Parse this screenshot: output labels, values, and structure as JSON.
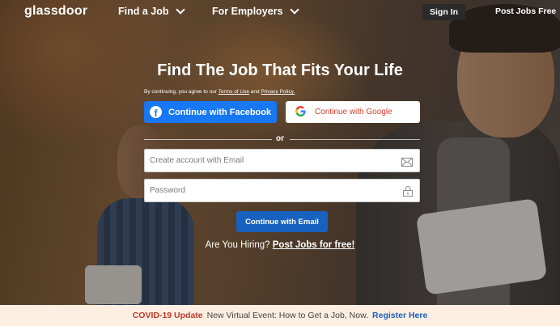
{
  "header": {
    "logo": "glassdoor",
    "nav": [
      {
        "label": "Find a Job"
      },
      {
        "label": "For Employers"
      }
    ],
    "sign_in": "Sign In",
    "post_jobs": "Post Jobs Free"
  },
  "hero": {
    "headline": "Find The Job That Fits Your Life",
    "terms_prefix": "By continuing, you agree to our",
    "terms_link": "Terms of Use",
    "terms_and": "and",
    "privacy_link": "Privacy Policy.",
    "facebook_button": "Continue with Facebook",
    "google_button": "Continue with Google",
    "or_text": "or",
    "email_placeholder": "Create account with Email",
    "password_placeholder": "Password",
    "email_button": "Continue with Email",
    "hiring_text": "Are You Hiring?",
    "hiring_link": "Post Jobs for free!"
  },
  "banner": {
    "label": "COVID-19 Update",
    "text": "New Virtual Event: How to Get a Job, Now.",
    "link": "Register Here"
  },
  "colors": {
    "facebook": "#1877f2",
    "primary_button": "#1861bf",
    "banner_bg": "#fdeee2",
    "covid_label": "#c0392b"
  },
  "icons": [
    "facebook-icon",
    "google-icon",
    "envelope-icon",
    "lock-icon",
    "chevron-down-icon"
  ]
}
